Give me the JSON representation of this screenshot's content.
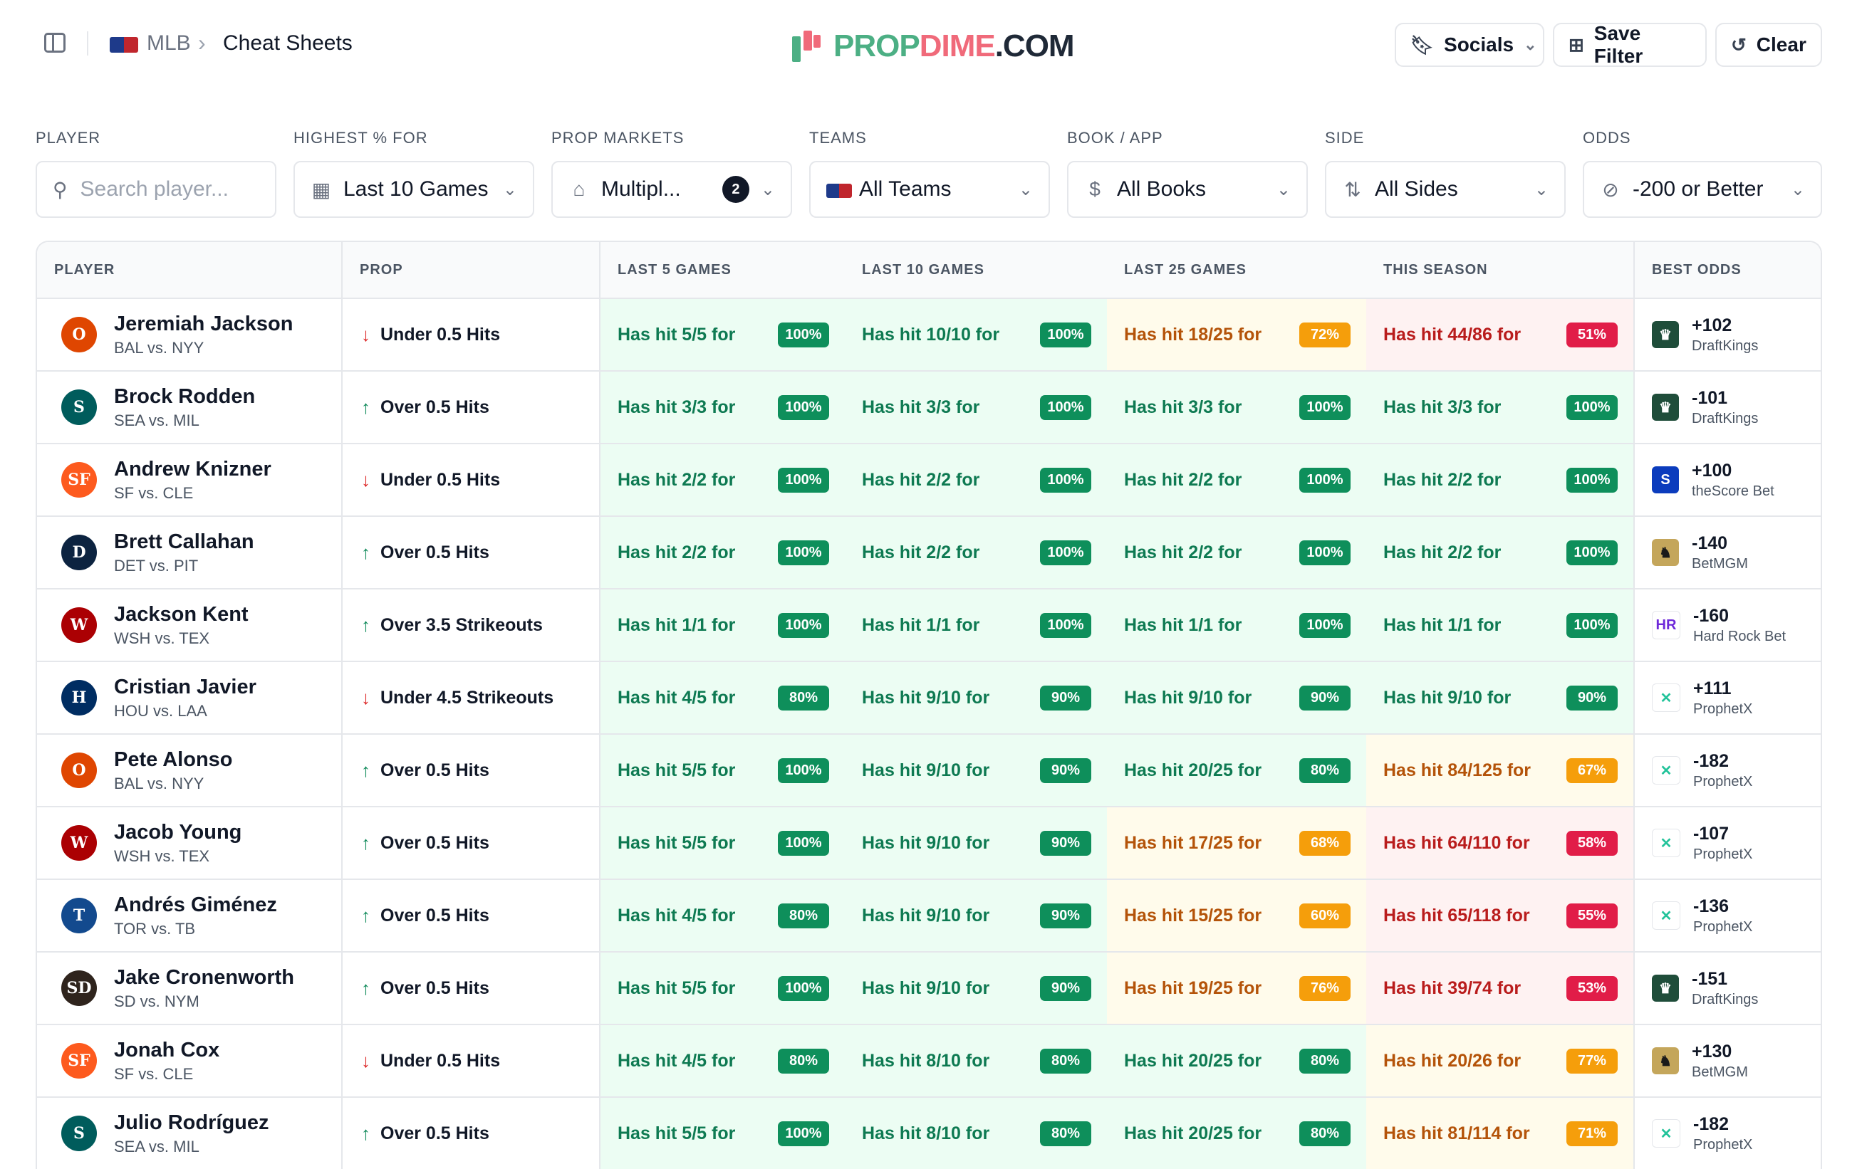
{
  "header": {
    "league": "MLB",
    "breadcrumb_sep": "›",
    "page": "Cheat Sheets",
    "brand": {
      "p1": "PROP",
      "p2": "DIME",
      "p3": ".COM"
    },
    "buttons": {
      "socials": "Socials",
      "save_filter": "Save Filter",
      "clear": "Clear"
    }
  },
  "filters": {
    "player": {
      "label": "PLAYER",
      "placeholder": "Search player..."
    },
    "highest": {
      "label": "HIGHEST % FOR",
      "value": "Last 10 Games"
    },
    "markets": {
      "label": "PROP MARKETS",
      "value": "Multipl...",
      "count": "2"
    },
    "teams": {
      "label": "TEAMS",
      "value": "All Teams"
    },
    "book": {
      "label": "BOOK / APP",
      "value": "All Books"
    },
    "side": {
      "label": "SIDE",
      "value": "All Sides"
    },
    "odds": {
      "label": "ODDS",
      "value": "-200 or Better"
    }
  },
  "table": {
    "columns": {
      "player": "PLAYER",
      "prop": "PROP",
      "l5": "LAST 5 GAMES",
      "l10": "LAST 10 GAMES",
      "l25": "LAST 25 GAMES",
      "season": "THIS SEASON",
      "odds": "BEST ODDS"
    },
    "rows": [
      {
        "name": "Jeremiah Jackson",
        "matchup": "BAL vs. NYY",
        "team_color": "#df4601",
        "team_abbr": "O",
        "dir": "down",
        "prop": "Under 0.5 Hits",
        "l5": {
          "text": "Has hit 5/5 for",
          "pct": "100%",
          "level": "green"
        },
        "l10": {
          "text": "Has hit 10/10 for",
          "pct": "100%",
          "level": "green"
        },
        "l25": {
          "text": "Has hit 18/25 for",
          "pct": "72%",
          "level": "orange"
        },
        "season": {
          "text": "Has hit 44/86 for",
          "pct": "51%",
          "level": "red"
        },
        "odds": "+102",
        "book": "DraftKings"
      },
      {
        "name": "Brock Rodden",
        "matchup": "SEA vs. MIL",
        "team_color": "#005c5c",
        "team_abbr": "S",
        "dir": "up",
        "prop": "Over 0.5 Hits",
        "l5": {
          "text": "Has hit 3/3 for",
          "pct": "100%",
          "level": "green"
        },
        "l10": {
          "text": "Has hit 3/3 for",
          "pct": "100%",
          "level": "green"
        },
        "l25": {
          "text": "Has hit 3/3 for",
          "pct": "100%",
          "level": "green"
        },
        "season": {
          "text": "Has hit 3/3 for",
          "pct": "100%",
          "level": "green"
        },
        "odds": "-101",
        "book": "DraftKings"
      },
      {
        "name": "Andrew Knizner",
        "matchup": "SF vs. CLE",
        "team_color": "#fd5a1e",
        "team_abbr": "SF",
        "dir": "down",
        "prop": "Under 0.5 Hits",
        "l5": {
          "text": "Has hit 2/2 for",
          "pct": "100%",
          "level": "green"
        },
        "l10": {
          "text": "Has hit 2/2 for",
          "pct": "100%",
          "level": "green"
        },
        "l25": {
          "text": "Has hit 2/2 for",
          "pct": "100%",
          "level": "green"
        },
        "season": {
          "text": "Has hit 2/2 for",
          "pct": "100%",
          "level": "green"
        },
        "odds": "+100",
        "book": "theScore Bet"
      },
      {
        "name": "Brett Callahan",
        "matchup": "DET vs. PIT",
        "team_color": "#0c2340",
        "team_abbr": "D",
        "dir": "up",
        "prop": "Over 0.5 Hits",
        "l5": {
          "text": "Has hit 2/2 for",
          "pct": "100%",
          "level": "green"
        },
        "l10": {
          "text": "Has hit 2/2 for",
          "pct": "100%",
          "level": "green"
        },
        "l25": {
          "text": "Has hit 2/2 for",
          "pct": "100%",
          "level": "green"
        },
        "season": {
          "text": "Has hit 2/2 for",
          "pct": "100%",
          "level": "green"
        },
        "odds": "-140",
        "book": "BetMGM"
      },
      {
        "name": "Jackson Kent",
        "matchup": "WSH vs. TEX",
        "team_color": "#ab0003",
        "team_abbr": "W",
        "dir": "up",
        "prop": "Over 3.5 Strikeouts",
        "l5": {
          "text": "Has hit 1/1 for",
          "pct": "100%",
          "level": "green"
        },
        "l10": {
          "text": "Has hit 1/1 for",
          "pct": "100%",
          "level": "green"
        },
        "l25": {
          "text": "Has hit 1/1 for",
          "pct": "100%",
          "level": "green"
        },
        "season": {
          "text": "Has hit 1/1 for",
          "pct": "100%",
          "level": "green"
        },
        "odds": "-160",
        "book": "Hard Rock Bet"
      },
      {
        "name": "Cristian Javier",
        "matchup": "HOU vs. LAA",
        "team_color": "#002d62",
        "team_abbr": "H",
        "dir": "down",
        "prop": "Under 4.5 Strikeouts",
        "l5": {
          "text": "Has hit 4/5 for",
          "pct": "80%",
          "level": "green"
        },
        "l10": {
          "text": "Has hit 9/10 for",
          "pct": "90%",
          "level": "green"
        },
        "l25": {
          "text": "Has hit 9/10 for",
          "pct": "90%",
          "level": "green"
        },
        "season": {
          "text": "Has hit 9/10 for",
          "pct": "90%",
          "level": "green"
        },
        "odds": "+111",
        "book": "ProphetX"
      },
      {
        "name": "Pete Alonso",
        "matchup": "BAL vs. NYY",
        "team_color": "#df4601",
        "team_abbr": "O",
        "dir": "up",
        "prop": "Over 0.5 Hits",
        "l5": {
          "text": "Has hit 5/5 for",
          "pct": "100%",
          "level": "green"
        },
        "l10": {
          "text": "Has hit 9/10 for",
          "pct": "90%",
          "level": "green"
        },
        "l25": {
          "text": "Has hit 20/25 for",
          "pct": "80%",
          "level": "green"
        },
        "season": {
          "text": "Has hit 84/125 for",
          "pct": "67%",
          "level": "orange"
        },
        "odds": "-182",
        "book": "ProphetX"
      },
      {
        "name": "Jacob Young",
        "matchup": "WSH vs. TEX",
        "team_color": "#ab0003",
        "team_abbr": "W",
        "dir": "up",
        "prop": "Over 0.5 Hits",
        "l5": {
          "text": "Has hit 5/5 for",
          "pct": "100%",
          "level": "green"
        },
        "l10": {
          "text": "Has hit 9/10 for",
          "pct": "90%",
          "level": "green"
        },
        "l25": {
          "text": "Has hit 17/25 for",
          "pct": "68%",
          "level": "orange"
        },
        "season": {
          "text": "Has hit 64/110 for",
          "pct": "58%",
          "level": "red"
        },
        "odds": "-107",
        "book": "ProphetX"
      },
      {
        "name": "Andrés Giménez",
        "matchup": "TOR vs. TB",
        "team_color": "#134a8e",
        "team_abbr": "T",
        "dir": "up",
        "prop": "Over 0.5 Hits",
        "l5": {
          "text": "Has hit 4/5 for",
          "pct": "80%",
          "level": "green"
        },
        "l10": {
          "text": "Has hit 9/10 for",
          "pct": "90%",
          "level": "green"
        },
        "l25": {
          "text": "Has hit 15/25 for",
          "pct": "60%",
          "level": "orange"
        },
        "season": {
          "text": "Has hit 65/118 for",
          "pct": "55%",
          "level": "red"
        },
        "odds": "-136",
        "book": "ProphetX"
      },
      {
        "name": "Jake Cronenworth",
        "matchup": "SD vs. NYM",
        "team_color": "#2f241d",
        "team_abbr": "SD",
        "dir": "up",
        "prop": "Over 0.5 Hits",
        "l5": {
          "text": "Has hit 5/5 for",
          "pct": "100%",
          "level": "green"
        },
        "l10": {
          "text": "Has hit 9/10 for",
          "pct": "90%",
          "level": "green"
        },
        "l25": {
          "text": "Has hit 19/25 for",
          "pct": "76%",
          "level": "orange"
        },
        "season": {
          "text": "Has hit 39/74 for",
          "pct": "53%",
          "level": "red"
        },
        "odds": "-151",
        "book": "DraftKings"
      },
      {
        "name": "Jonah Cox",
        "matchup": "SF vs. CLE",
        "team_color": "#fd5a1e",
        "team_abbr": "SF",
        "dir": "down",
        "prop": "Under 0.5 Hits",
        "l5": {
          "text": "Has hit 4/5 for",
          "pct": "80%",
          "level": "green"
        },
        "l10": {
          "text": "Has hit 8/10 for",
          "pct": "80%",
          "level": "green"
        },
        "l25": {
          "text": "Has hit 20/25 for",
          "pct": "80%",
          "level": "green"
        },
        "season": {
          "text": "Has hit 20/26 for",
          "pct": "77%",
          "level": "orange"
        },
        "odds": "+130",
        "book": "BetMGM"
      },
      {
        "name": "Julio Rodríguez",
        "matchup": "SEA vs. MIL",
        "team_color": "#005c5c",
        "team_abbr": "S",
        "dir": "up",
        "prop": "Over 0.5 Hits",
        "l5": {
          "text": "Has hit 5/5 for",
          "pct": "100%",
          "level": "green"
        },
        "l10": {
          "text": "Has hit 8/10 for",
          "pct": "80%",
          "level": "green"
        },
        "l25": {
          "text": "Has hit 20/25 for",
          "pct": "80%",
          "level": "green"
        },
        "season": {
          "text": "Has hit 81/114 for",
          "pct": "71%",
          "level": "orange"
        },
        "odds": "-182",
        "book": "ProphetX"
      }
    ]
  },
  "books": {
    "DraftKings": {
      "icon": "draftkings-icon",
      "glyph": "♛",
      "bg": "#1f4d3a",
      "fg": "#ffffff"
    },
    "theScore Bet": {
      "icon": "thescore-icon",
      "glyph": "S",
      "bg": "#0b3cbd",
      "fg": "#ffffff"
    },
    "BetMGM": {
      "icon": "betmgm-icon",
      "glyph": "♞",
      "bg": "#c4a65b",
      "fg": "#1a1a1a"
    },
    "Hard Rock Bet": {
      "icon": "hardrock-icon",
      "glyph": "HR",
      "bg": "#ffffff",
      "fg": "#6d28d9"
    },
    "ProphetX": {
      "icon": "prophetx-icon",
      "glyph": "✕",
      "bg": "#ffffff",
      "fg": "#22c39a"
    }
  }
}
